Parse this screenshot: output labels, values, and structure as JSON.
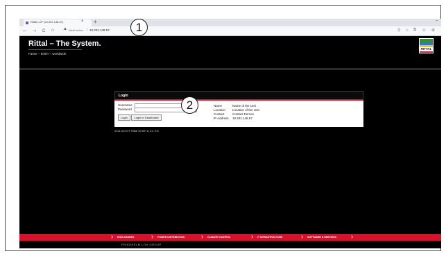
{
  "browser": {
    "tab_title": "Rittal LCP (10.201.148.57)",
    "tab_close": "×",
    "new_tab": "+",
    "minimize": "–",
    "nav": {
      "back": "←",
      "forward": "→",
      "reload": "C",
      "home": "⌂"
    },
    "address": {
      "warning": "▲",
      "insecure_label": "Nicht sicher",
      "separator": "|",
      "url": "10.201.148.57"
    },
    "toolbar_icons": [
      "⚲",
      "☆",
      "⧉",
      "✩",
      "⊕"
    ]
  },
  "header": {
    "brand": "Rittal – The System.",
    "tagline": "Faster – better – worldwide.",
    "logo_text": "RITTAL"
  },
  "login": {
    "title": "Login",
    "username_label": "Username",
    "password_label": "Password",
    "username_value": "",
    "password_value": "",
    "login_button": "Login",
    "dashboard_button": "Login to Dashboard"
  },
  "unit_info": {
    "rows": [
      {
        "key": "Name",
        "value": "Name of the Unit"
      },
      {
        "key": "Location",
        "value": "Location of the Unit"
      },
      {
        "key": "Contact",
        "value": "Contact Person"
      },
      {
        "key": "IP Address",
        "value": "10.201.148.57"
      }
    ]
  },
  "copyright": "2011-2023 © Rittal GmbH & Co. KG",
  "callouts": [
    "1",
    "2"
  ],
  "footer": {
    "items": [
      "ENCLOSURES",
      "POWER DISTRIBUTION",
      "CLIMATE CONTROL",
      "IT INFRASTRUCTURE",
      "SOFTWARE & SERVICES"
    ],
    "group": "FRIEDHELM LOH GROUP"
  },
  "colors": {
    "accent": "#d8102c",
    "page_bg": "#000000",
    "chrome_bg": "#dfe3e8"
  }
}
